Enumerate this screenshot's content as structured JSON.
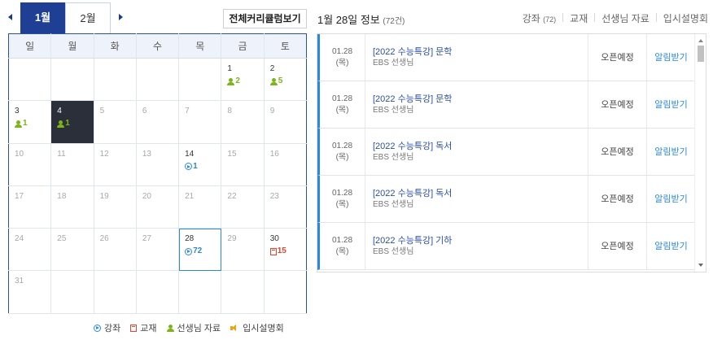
{
  "calendar": {
    "tabs": [
      {
        "label": "1월",
        "active": true
      },
      {
        "label": "2월",
        "active": false
      }
    ],
    "curriculum_button": "전체커리큘럼보기",
    "weekdays": [
      "일",
      "월",
      "화",
      "수",
      "목",
      "금",
      "토"
    ],
    "events": {
      "feb1_teacher": "2",
      "feb2_teacher": "5",
      "feb3_teacher": "1",
      "feb4_teacher": "1",
      "feb14_lecture": "1",
      "feb28_lecture": "72",
      "feb30_book": "15"
    },
    "cells": [
      [
        "",
        "",
        "",
        "",
        "",
        "1",
        "2"
      ],
      [
        "3",
        "4",
        "5",
        "6",
        "7",
        "8",
        "9"
      ],
      [
        "10",
        "11",
        "12",
        "13",
        "14",
        "15",
        "16"
      ],
      [
        "17",
        "18",
        "19",
        "20",
        "21",
        "22",
        "23"
      ],
      [
        "24",
        "25",
        "26",
        "27",
        "28",
        "29",
        "30"
      ],
      [
        "31",
        "",
        "",
        "",
        "",
        "",
        ""
      ]
    ],
    "colors": {
      "tab_active": "#1f3f95",
      "today_bg": "#2b2f3a",
      "teacher": "#7cb518",
      "lecture": "#2b8ad6",
      "book": "#e8412c",
      "briefing": "#f2a20c"
    },
    "legend": [
      {
        "icon": "lecture-icon",
        "label": "강좌"
      },
      {
        "icon": "book-icon",
        "label": "교재"
      },
      {
        "icon": "teacher-icon",
        "label": "선생님 자료"
      },
      {
        "icon": "speaker-icon",
        "label": "입시설명회"
      }
    ]
  },
  "info": {
    "title": "1월 28일 정보",
    "count": "(72건)",
    "filters": [
      {
        "label": "강좌",
        "count": "(72)"
      },
      {
        "label": "교재"
      },
      {
        "label": "선생님 자료"
      },
      {
        "label": "입시설명회"
      }
    ]
  },
  "list": {
    "items": [
      {
        "date": "01.28",
        "weekday": "(목)",
        "title": "[2022 수능특강] 문학",
        "teacher": "EBS 선생님",
        "status": "오픈예정",
        "action": "알림받기"
      },
      {
        "date": "01.28",
        "weekday": "(목)",
        "title": "[2022 수능특강] 문학",
        "teacher": "EBS 선생님",
        "status": "오픈예정",
        "action": "알림받기"
      },
      {
        "date": "01.28",
        "weekday": "(목)",
        "title": "[2022 수능특강] 독서",
        "teacher": "EBS 선생님",
        "status": "오픈예정",
        "action": "알림받기"
      },
      {
        "date": "01.28",
        "weekday": "(목)",
        "title": "[2022 수능특강] 독서",
        "teacher": "EBS 선생님",
        "status": "오픈예정",
        "action": "알림받기"
      },
      {
        "date": "01.28",
        "weekday": "(목)",
        "title": "[2022 수능특강] 기하",
        "teacher": "EBS 선생님",
        "status": "오픈예정",
        "action": "알림받기"
      }
    ]
  }
}
